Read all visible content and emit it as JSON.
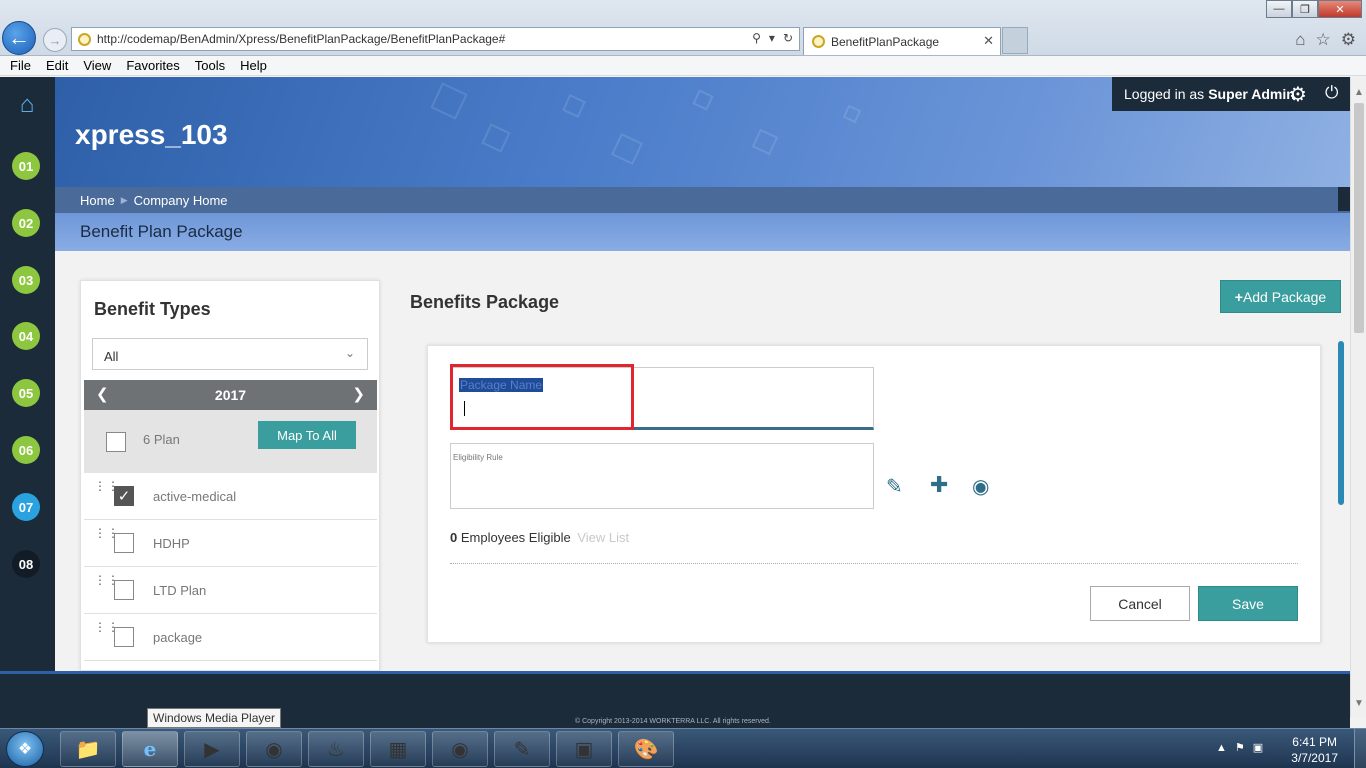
{
  "browser": {
    "url": "http://codemap/BenAdmin/Xpress/BenefitPlanPackage/BenefitPlanPackage#",
    "tab_title": "BenefitPlanPackage",
    "menu": [
      "File",
      "Edit",
      "View",
      "Favorites",
      "Tools",
      "Help"
    ]
  },
  "side_nav": {
    "steps": [
      {
        "label": "01",
        "state": "done"
      },
      {
        "label": "02",
        "state": "done"
      },
      {
        "label": "03",
        "state": "done"
      },
      {
        "label": "04",
        "state": "done"
      },
      {
        "label": "05",
        "state": "done"
      },
      {
        "label": "06",
        "state": "done"
      },
      {
        "label": "07",
        "state": "current"
      },
      {
        "label": "08",
        "state": "todo"
      }
    ]
  },
  "header": {
    "company": "xpress_103",
    "logged_in_prefix": "Logged in as",
    "user": "Super Admin",
    "breadcrumb": [
      "Home",
      "Company Home"
    ],
    "page_heading": "Benefit Plan Package"
  },
  "benefit_types": {
    "title": "Benefit Types",
    "filter_value": "All",
    "year": "2017",
    "plan_count": "6 Plan",
    "map_to_all_label": "Map To All",
    "plans": [
      {
        "name": "active-medical",
        "checked": true
      },
      {
        "name": "HDHP",
        "checked": false
      },
      {
        "name": "LTD Plan",
        "checked": false
      },
      {
        "name": "package",
        "checked": false
      }
    ]
  },
  "benefits_package": {
    "title": "Benefits Package",
    "add_label": "Add Package",
    "package_name_placeholder": "Package Name",
    "eligibility_label": "Eligibility Rule",
    "eligible_count": "0",
    "eligible_text": "Employees Eligible",
    "view_list_label": "View List",
    "cancel_label": "Cancel",
    "save_label": "Save"
  },
  "footer": {
    "copyright": "© Copyright 2013-2014 WORKTERRA LLC. All rights reserved."
  },
  "tooltip": "Windows Media Player",
  "taskbar": {
    "time": "6:41 PM",
    "date": "3/7/2017"
  },
  "colors": {
    "accent_teal": "#3a9e9e",
    "nav_dark": "#1c2b3a",
    "step_done": "#8dc63f",
    "step_current": "#2aa2e0",
    "highlight_red": "#e0262e"
  }
}
